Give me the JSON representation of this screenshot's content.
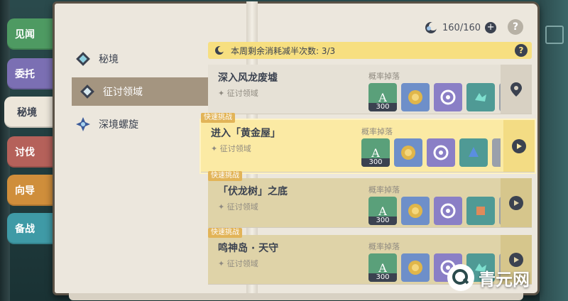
{
  "left_tabs": [
    {
      "label": "见闻",
      "color": "#4e9a62"
    },
    {
      "label": "委托",
      "color": "#7b6fb3"
    },
    {
      "label": "秘境",
      "color": "#ece6da",
      "active": true
    },
    {
      "label": "讨伐",
      "color": "#b5615a"
    },
    {
      "label": "向导",
      "color": "#cf8e3b"
    },
    {
      "label": "备战",
      "color": "#3f9aa6"
    }
  ],
  "menu": [
    {
      "label": "秘境",
      "icon": "domain-diamond-icon"
    },
    {
      "label": "征讨领域",
      "icon": "trounce-domain-icon",
      "selected": true
    },
    {
      "label": "深境螺旋",
      "icon": "spiral-abyss-icon"
    }
  ],
  "resin": {
    "text": "160/160",
    "icon": "original-resin-icon",
    "plus": "+"
  },
  "help": "?",
  "notice": {
    "text": "本周剩余消耗减半次数: 3/3",
    "help": "?"
  },
  "drops_label": "概率掉落",
  "quick_badge": "快速挑战",
  "domains": [
    {
      "title": "深入风龙废墟",
      "sub": "征讨领域",
      "count": "300",
      "quick": false,
      "action_icon": "location-pin-icon"
    },
    {
      "title": "进入「黄金屋」",
      "sub": "征讨领域",
      "count": "300",
      "quick": true,
      "action_icon": "play-arrow-icon"
    },
    {
      "title": "「伏龙树」之底",
      "sub": "征讨领域",
      "count": "300",
      "quick": true,
      "action_icon": "play-arrow-icon"
    },
    {
      "title": "鸣神岛 · 天守",
      "sub": "征讨领域",
      "count": "300",
      "quick": true,
      "action_icon": "play-arrow-icon"
    }
  ],
  "watermark": {
    "text": "青元网",
    "icon": "watermark-logo-icon"
  }
}
